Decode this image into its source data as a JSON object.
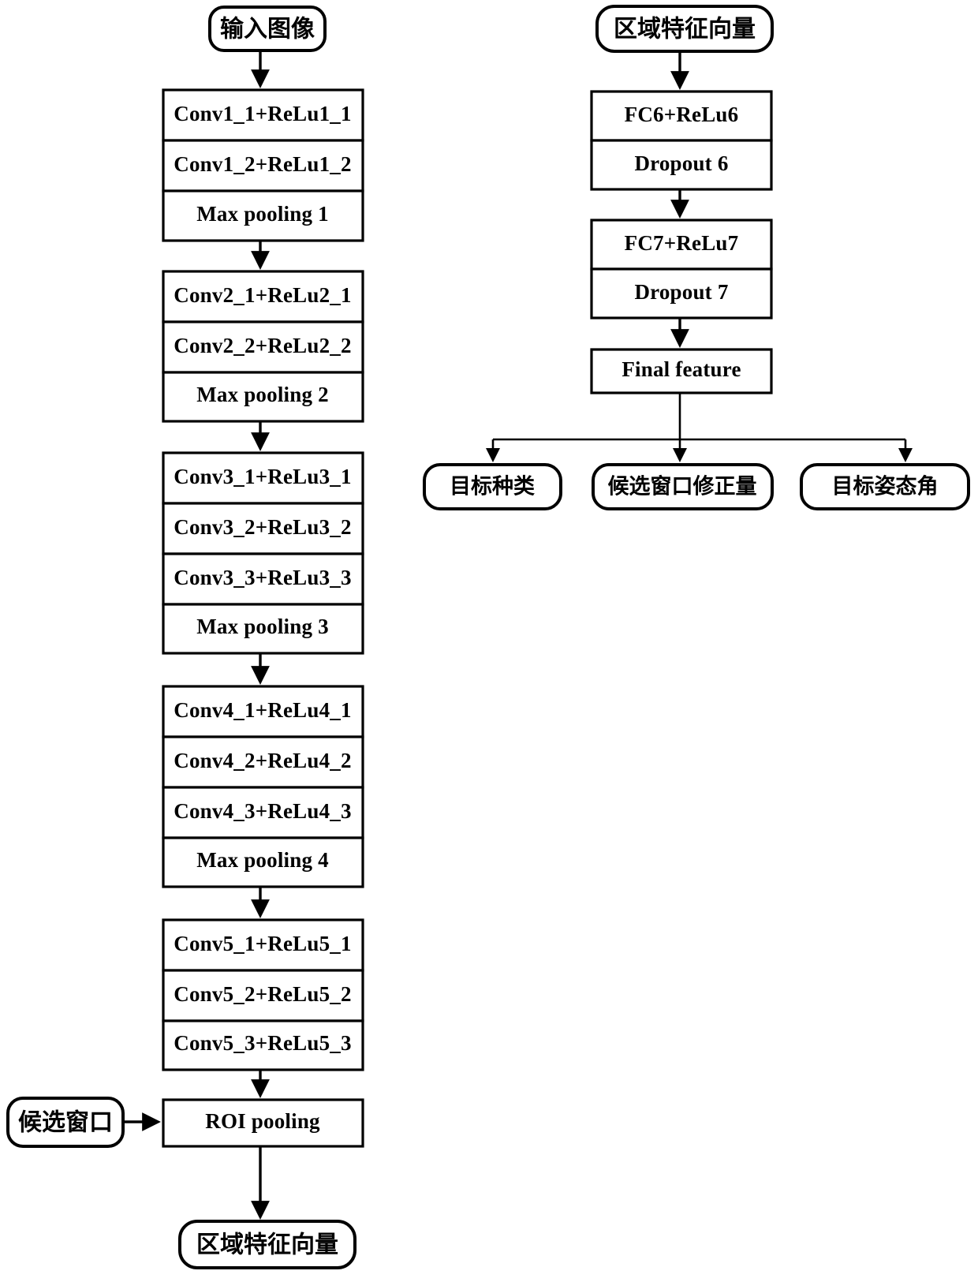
{
  "diagram": {
    "title": "Faster R-CNN VGG16 backbone and head flowchart",
    "colors": {
      "stroke": "#000000",
      "fill": "#ffffff",
      "text": "#000000"
    },
    "left_column": {
      "input_node": {
        "label": "输入图像"
      },
      "blocks": [
        {
          "name": "conv-block-1",
          "rows": [
            {
              "label": "Conv1_1+ReLu1_1"
            },
            {
              "label": "Conv1_2+ReLu1_2"
            },
            {
              "label": "Max pooling 1"
            }
          ]
        },
        {
          "name": "conv-block-2",
          "rows": [
            {
              "label": "Conv2_1+ReLu2_1"
            },
            {
              "label": "Conv2_2+ReLu2_2"
            },
            {
              "label": "Max pooling 2"
            }
          ]
        },
        {
          "name": "conv-block-3",
          "rows": [
            {
              "label": "Conv3_1+ReLu3_1"
            },
            {
              "label": "Conv3_2+ReLu3_2"
            },
            {
              "label": "Conv3_3+ReLu3_3"
            },
            {
              "label": "Max pooling 3"
            }
          ]
        },
        {
          "name": "conv-block-4",
          "rows": [
            {
              "label": "Conv4_1+ReLu4_1"
            },
            {
              "label": "Conv4_2+ReLu4_2"
            },
            {
              "label": "Conv4_3+ReLu4_3"
            },
            {
              "label": "Max pooling 4"
            }
          ]
        },
        {
          "name": "conv-block-5",
          "rows": [
            {
              "label": "Conv5_1+ReLu5_1"
            },
            {
              "label": "Conv5_2+ReLu5_2"
            },
            {
              "label": "Conv5_3+ReLu5_3"
            }
          ]
        }
      ],
      "proposal_node": {
        "label": "候选窗口"
      },
      "roi_pooling": {
        "label": "ROI pooling"
      },
      "output_node": {
        "label": "区域特征向量"
      }
    },
    "right_column": {
      "input_node": {
        "label": "区域特征向量"
      },
      "blocks": [
        {
          "name": "fc6-block",
          "rows": [
            {
              "label": "FC6+ReLu6"
            },
            {
              "label": "Dropout 6"
            }
          ]
        },
        {
          "name": "fc7-block",
          "rows": [
            {
              "label": "FC7+ReLu7"
            },
            {
              "label": "Dropout 7"
            }
          ]
        }
      ],
      "final_feature": {
        "label": "Final feature"
      },
      "outputs": [
        {
          "label": "目标种类"
        },
        {
          "label": "候选窗口修正量"
        },
        {
          "label": "目标姿态角"
        }
      ]
    }
  }
}
